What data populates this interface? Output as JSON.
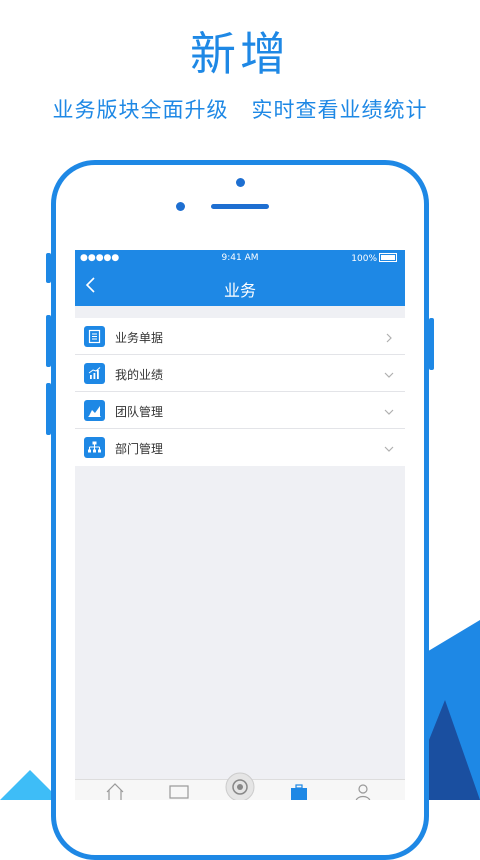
{
  "promo": {
    "headline": "新增",
    "subline": "业务版块全面升级   实时查看业绩统计"
  },
  "phone_screen": {
    "status_bar": {
      "signal": "●●●●● ",
      "time": "9:41 AM",
      "battery": "100%"
    },
    "nav_bar": {
      "back_icon": "chevron-left-icon",
      "title": "业务"
    },
    "menu_items": [
      {
        "label": "业务单据",
        "icon": "document-icon",
        "indicator": "chevron-right"
      },
      {
        "label": "我的业绩",
        "icon": "bar-chart-icon",
        "indicator": "chevron-down"
      },
      {
        "label": "团队管理",
        "icon": "team-chart-icon",
        "indicator": "chevron-down"
      },
      {
        "label": "部门管理",
        "icon": "org-chart-icon",
        "indicator": "chevron-down"
      }
    ],
    "tab_bar": [
      "home-icon",
      "monitor-icon",
      "center-camera-icon",
      "briefcase-icon",
      "person-icon"
    ]
  },
  "colors": {
    "accent": "#1e88e5",
    "dark_blue": "#1a4fa0",
    "background": "#eff0f4"
  }
}
